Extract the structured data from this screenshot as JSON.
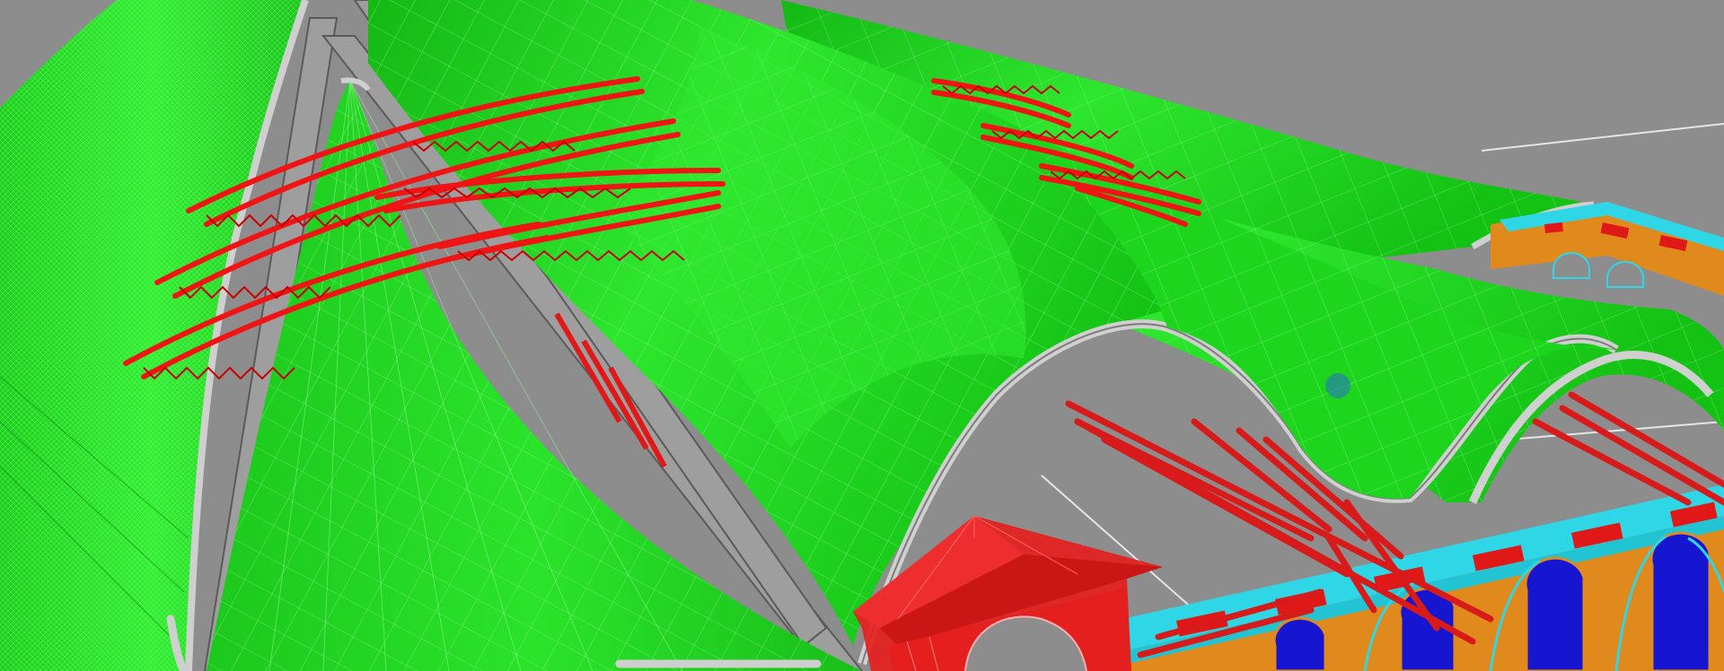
{
  "viewport": {
    "kind": "3d-model-view",
    "background_color": "#8d8d8d",
    "display_mode": "shaded-with-wireframe"
  },
  "colors": {
    "membrane": "#1ed51e",
    "membrane_dark": "#12b812",
    "membrane_light": "#33f033",
    "mesh_lines": "#8ff58f",
    "edge_tube": "#c9c9c9",
    "truss": "#f01414",
    "gatehouse": "#e51e1e",
    "arcade_facade": "#e08a1e",
    "arcade_trim": "#2fd6e6",
    "window_glass": "#1616d0",
    "support_rods": "#d81a1a",
    "grid_line": "#ececec"
  },
  "objects": [
    {
      "name": "membrane-roof-left-panel",
      "color": "membrane"
    },
    {
      "name": "membrane-roof-cone",
      "color": "membrane"
    },
    {
      "name": "membrane-roof-central-vault",
      "color": "membrane"
    },
    {
      "name": "membrane-roof-right-vault",
      "color": "membrane"
    },
    {
      "name": "steel-truss-group-left",
      "color": "truss"
    },
    {
      "name": "steel-truss-group-right",
      "color": "truss"
    },
    {
      "name": "gatehouse",
      "color": "gatehouse"
    },
    {
      "name": "arcade-building-right",
      "color": "arcade_facade"
    },
    {
      "name": "support-rods",
      "color": "support_rods"
    }
  ]
}
